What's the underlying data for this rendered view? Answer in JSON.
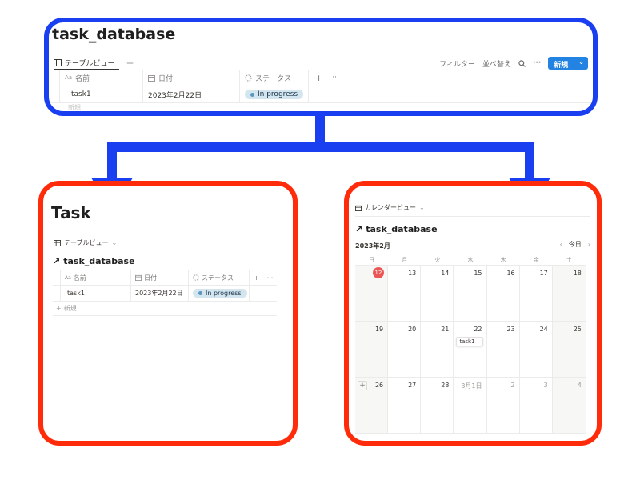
{
  "colors": {
    "frame_top": "#1a3ff0",
    "frame_bottom": "#ff2b0a",
    "accent": "#2383e2",
    "status_pill": "#d3e5ef"
  },
  "top": {
    "title": "task_database",
    "view_tab": "テーブルビュー",
    "actions": {
      "filter": "フィルター",
      "sort": "並べ替え",
      "new": "新規"
    },
    "columns": {
      "name": "名前",
      "date": "日付",
      "status": "ステータス"
    },
    "row": {
      "name": "task1",
      "date": "2023年2月22日",
      "status": "In progress"
    },
    "new_row": "新規"
  },
  "left": {
    "page_title": "Task",
    "view_tab": "テーブルビュー",
    "db_title": "task_database",
    "columns": {
      "name": "名前",
      "date": "日付",
      "status": "ステータス"
    },
    "row": {
      "name": "task1",
      "date": "2023年2月22日",
      "status": "In progress"
    },
    "new_row": "新規"
  },
  "right": {
    "view_tab": "カレンダービュー",
    "db_title": "task_database",
    "month": "2023年2月",
    "today_label": "今日",
    "weekdays": [
      "日",
      "月",
      "火",
      "水",
      "木",
      "金",
      "土"
    ],
    "weeks": [
      [
        "12",
        "13",
        "14",
        "15",
        "16",
        "17",
        "18"
      ],
      [
        "19",
        "20",
        "21",
        "22",
        "23",
        "24",
        "25"
      ],
      [
        "26",
        "27",
        "28",
        "3月1日",
        "2",
        "3",
        "4"
      ]
    ],
    "event": "task1"
  }
}
